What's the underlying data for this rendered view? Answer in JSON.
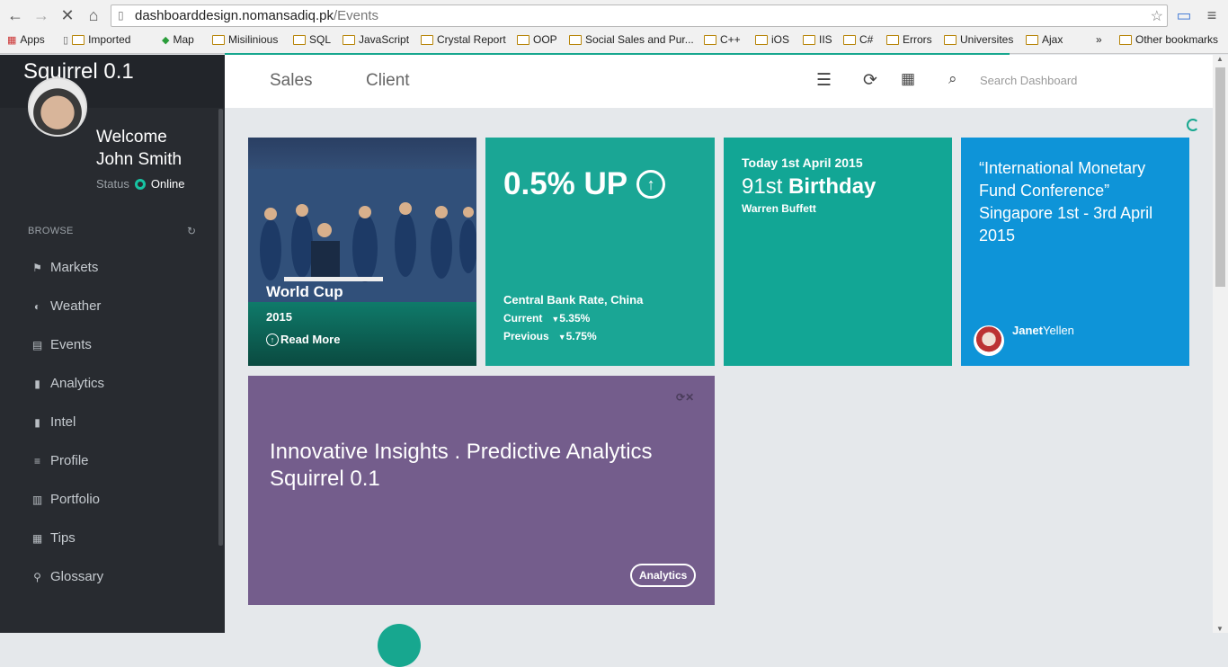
{
  "browser": {
    "url_host": "dashboarddesign.nomansadiq.pk",
    "url_path": "/Events",
    "bookmarks": [
      "Apps",
      "Imported",
      "Map",
      "Misilinious",
      "SQL",
      "JavaScript",
      "Crystal Report",
      "OOP",
      "Social Sales and Pur...",
      "C++",
      "iOS",
      "IIS",
      "C#",
      "Errors",
      "Universites",
      "Ajax",
      "»",
      "Other bookmarks"
    ]
  },
  "sidebar": {
    "brand": "Squirrel 0.1",
    "welcome": "Welcome",
    "user_name": "John Smith",
    "status_label": "Status",
    "status_value": "Online",
    "section": "BROWSE",
    "items": [
      {
        "label": "Markets",
        "icon": "flag-icon"
      },
      {
        "label": "Weather",
        "icon": "contrast-icon"
      },
      {
        "label": "Events",
        "icon": "document-icon"
      },
      {
        "label": "Analytics",
        "icon": "bookmark-icon"
      },
      {
        "label": "Intel",
        "icon": "bookmark-icon"
      },
      {
        "label": "Profile",
        "icon": "list-icon"
      },
      {
        "label": "Portfolio",
        "icon": "book-icon"
      },
      {
        "label": "Tips",
        "icon": "grid-icon"
      },
      {
        "label": "Glossary",
        "icon": "pin-icon"
      }
    ]
  },
  "topbar": {
    "tabs": [
      "Sales",
      "Client"
    ],
    "search_placeholder": "Search Dashboard"
  },
  "cards": {
    "worldcup": {
      "title": "World Cup",
      "year": "2015",
      "more": "Read More"
    },
    "rate": {
      "headline": "0.5% UP",
      "label": "Central Bank Rate, China",
      "current_label": "Current",
      "current_value": "5.35%",
      "previous_label": "Previous",
      "previous_value": "5.75%"
    },
    "birthday": {
      "date": "Today 1st April 2015",
      "ordinal": "91st",
      "event": "Birthday",
      "name": "Warren Buffett"
    },
    "quote": {
      "text": "“International Monetary Fund Conference” Singapore 1st - 3rd April 2015",
      "first": "Janet",
      "last": "Yellen"
    },
    "insights": {
      "line1": "Innovative Insights . Predictive Analytics",
      "line2": "Squirrel 0.1",
      "tag": "Analytics"
    }
  },
  "colors": {
    "accent": "#17a78f",
    "blue": "#0e94d8",
    "purple": "#745d8c",
    "sidebar": "#282b30"
  }
}
